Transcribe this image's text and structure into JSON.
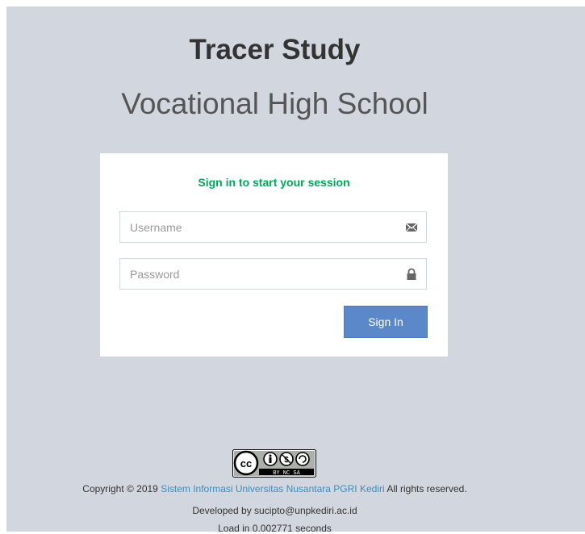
{
  "header": {
    "title": "Tracer Study",
    "subtitle": "Vocational High School"
  },
  "login": {
    "message": "Sign in to start your session",
    "username_placeholder": "Username",
    "password_placeholder": "Password",
    "username_icon": "envelope-icon",
    "password_icon": "lock-icon",
    "signin_label": "Sign In"
  },
  "footer": {
    "license_badge": "cc-by-nc-sa-badge",
    "license_badge_text": "BY NC SA",
    "copyright_prefix": "Copyright © 2019",
    "copyright_link": "Sistem Informasi Universitas Nusantara PGRI Kediri",
    "copyright_suffix": "All rights reserved.",
    "developer": "Developed by sucipto@unpkediri.ac.id",
    "load_time": "Load in 0.002771 seconds"
  },
  "colors": {
    "background": "#d2d6de",
    "accent_green": "#00a65a",
    "button_blue": "#5b88c8",
    "link_blue": "#3c8dbc"
  }
}
